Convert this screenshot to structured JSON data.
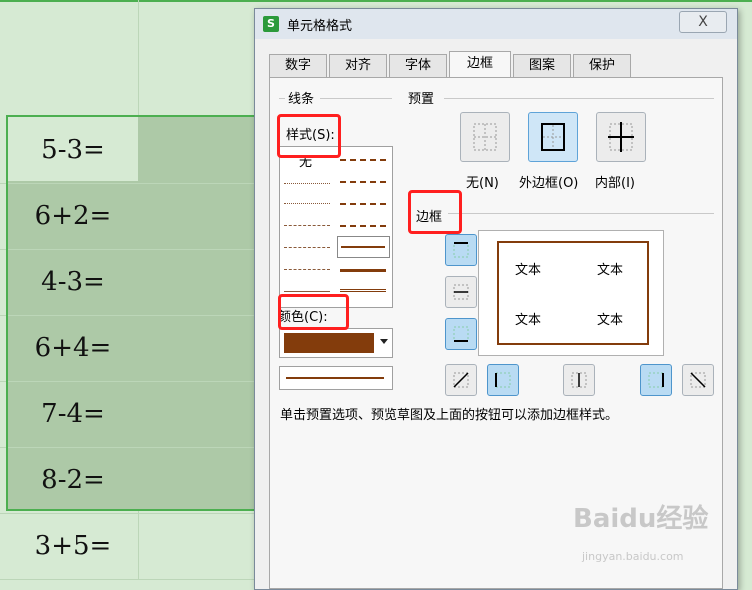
{
  "spreadsheet": {
    "cells": [
      "5-3=",
      "6+2=",
      "4-3=",
      "6+4=",
      "7-4=",
      "8-2=",
      "3+5="
    ]
  },
  "dialog": {
    "title": "单元格格式",
    "close": "X",
    "app_icon": "S",
    "tabs": [
      "数字",
      "对齐",
      "字体",
      "边框",
      "图案",
      "保护"
    ],
    "active_tab": "边框",
    "line_group": "线条",
    "style_label": "样式(S):",
    "style_none": "无",
    "color_label": "颜色(C):",
    "color_value": "#833c0c",
    "preset_group": "预置",
    "presets": [
      "无(N)",
      "外边框(O)",
      "内部(I)"
    ],
    "border_group": "边框",
    "preview_texts": [
      "文本",
      "文本",
      "文本",
      "文本"
    ],
    "hint": "单击预置选项、预览草图及上面的按钮可以添加边框样式。"
  },
  "watermark": {
    "brand": "Baidu经验",
    "url": "jingyan.baidu.com"
  }
}
